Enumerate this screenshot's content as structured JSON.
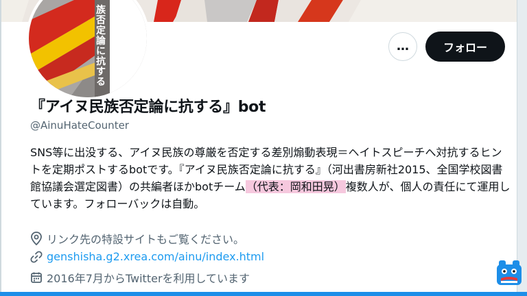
{
  "avatar": {
    "text": "族否定論に抗する"
  },
  "actions": {
    "more_label": "…",
    "follow_label": "フォロー"
  },
  "profile": {
    "display_name": "『アイヌ民族否定論に抗する』bot",
    "handle": "@AinuHateCounter",
    "bio_part1": "SNS等に出没する、アイヌ民族の尊厳を否定する差別煽動表現＝ヘイトスピーチへ対抗するヒントを定期ポストするbotです。『アイヌ民族否定論に抗する』（河出書房新社2015、全国学校図書館協議会選定図書）の共編者ほかbotチーム",
    "bio_highlight": "（代表：岡和田晃）",
    "bio_part2": "複数人が、個人の責任にて運用しています。フォローバックは自動。",
    "location": "リンク先の特設サイトもご覧ください。",
    "website": "genshisha.g2.xrea.com/ainu/index.html",
    "joined": "2016年7月からTwitterを利用しています"
  },
  "colors": {
    "link": "#1d9bf0",
    "secondary_text": "#536471",
    "highlight": "#f6c8de",
    "bottom_bar": "#1d8ee8"
  }
}
